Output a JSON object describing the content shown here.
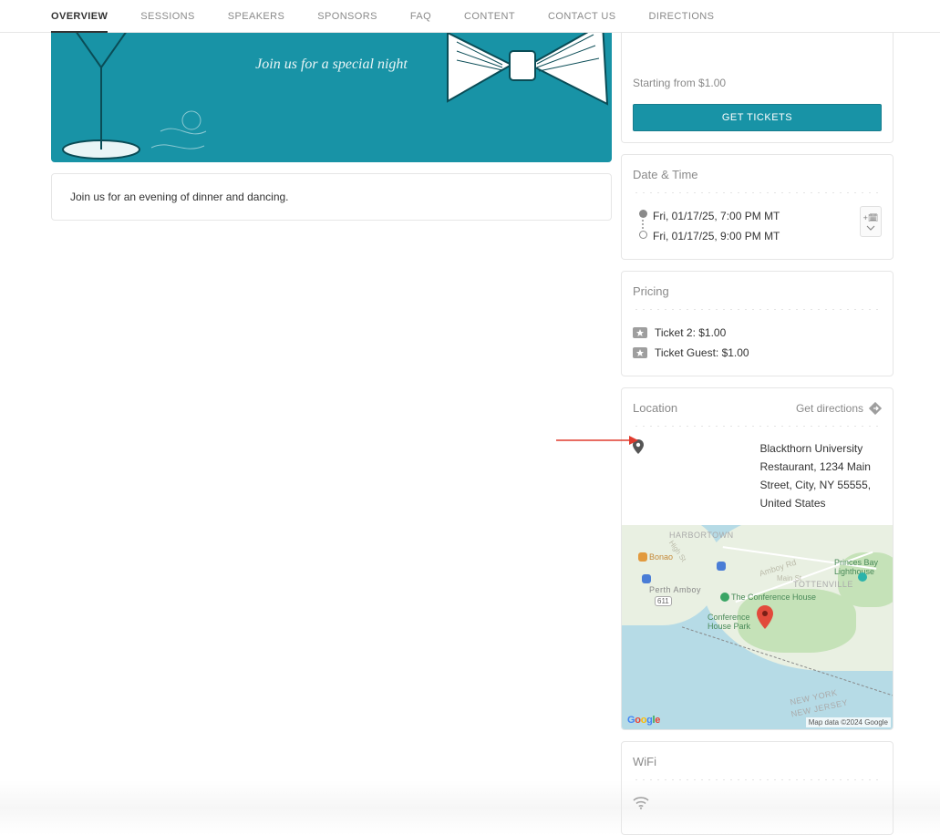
{
  "nav": {
    "items": [
      {
        "label": "OVERVIEW",
        "active": true
      },
      {
        "label": "SESSIONS"
      },
      {
        "label": "SPEAKERS"
      },
      {
        "label": "SPONSORS"
      },
      {
        "label": "FAQ"
      },
      {
        "label": "CONTENT"
      },
      {
        "label": "CONTACT US"
      },
      {
        "label": "DIRECTIONS"
      }
    ]
  },
  "hero": {
    "tagline": "Join us for a special night"
  },
  "main": {
    "description": "Join us for an evening of dinner and dancing."
  },
  "sidebar": {
    "starting_from": "Starting from $1.00",
    "get_tickets_label": "GET TICKETS",
    "date_time": {
      "title": "Date & Time",
      "start": "Fri, 01/17/25, 7:00 PM MT",
      "end": "Fri, 01/17/25, 9:00 PM MT"
    },
    "pricing": {
      "title": "Pricing",
      "items": [
        "Ticket 2: $1.00",
        "Ticket Guest: $1.00"
      ]
    },
    "location": {
      "title": "Location",
      "get_directions": "Get directions",
      "address": "Blackthorn University Restaurant, 1234 Main Street, City, NY 55555, United States"
    },
    "map": {
      "area_labels": [
        "HARBORTOWN",
        "TOTTENVILLE",
        "NEW YORK",
        "NEW JERSEY",
        "Perth Amboy"
      ],
      "poi_labels": [
        "Bonao",
        "The Conference House",
        "Conference House Park",
        "Princes Bay Lighthouse"
      ],
      "roads": [
        "Amboy Rd",
        "Main St",
        "High St"
      ],
      "shields": [
        "611"
      ],
      "logo": "Google",
      "attribution": "Map data ©2024 Google"
    },
    "wifi": {
      "title": "WiFi"
    }
  }
}
